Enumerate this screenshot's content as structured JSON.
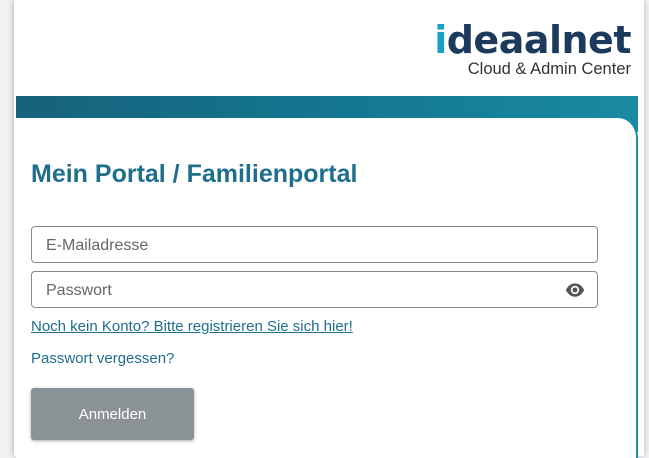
{
  "logo": {
    "brand_prefix": "i",
    "brand_rest": "deaalnet",
    "subtitle": "Cloud & Admin Center"
  },
  "login": {
    "title": "Mein Portal / Familienportal",
    "email_placeholder": "E-Mailadresse",
    "password_placeholder": "Passwort",
    "register_link": "Noch kein Konto? Bitte registrieren Sie sich hier!",
    "forgot_link": "Passwort vergessen?",
    "submit_label": "Anmelden"
  },
  "colors": {
    "brand_dark": "#1b3a5c",
    "brand_accent": "#18a0c7",
    "title": "#1e6e8c",
    "banner": "#16627a",
    "button": "#8b9296"
  },
  "icons": {
    "password_toggle": "eye-icon"
  }
}
